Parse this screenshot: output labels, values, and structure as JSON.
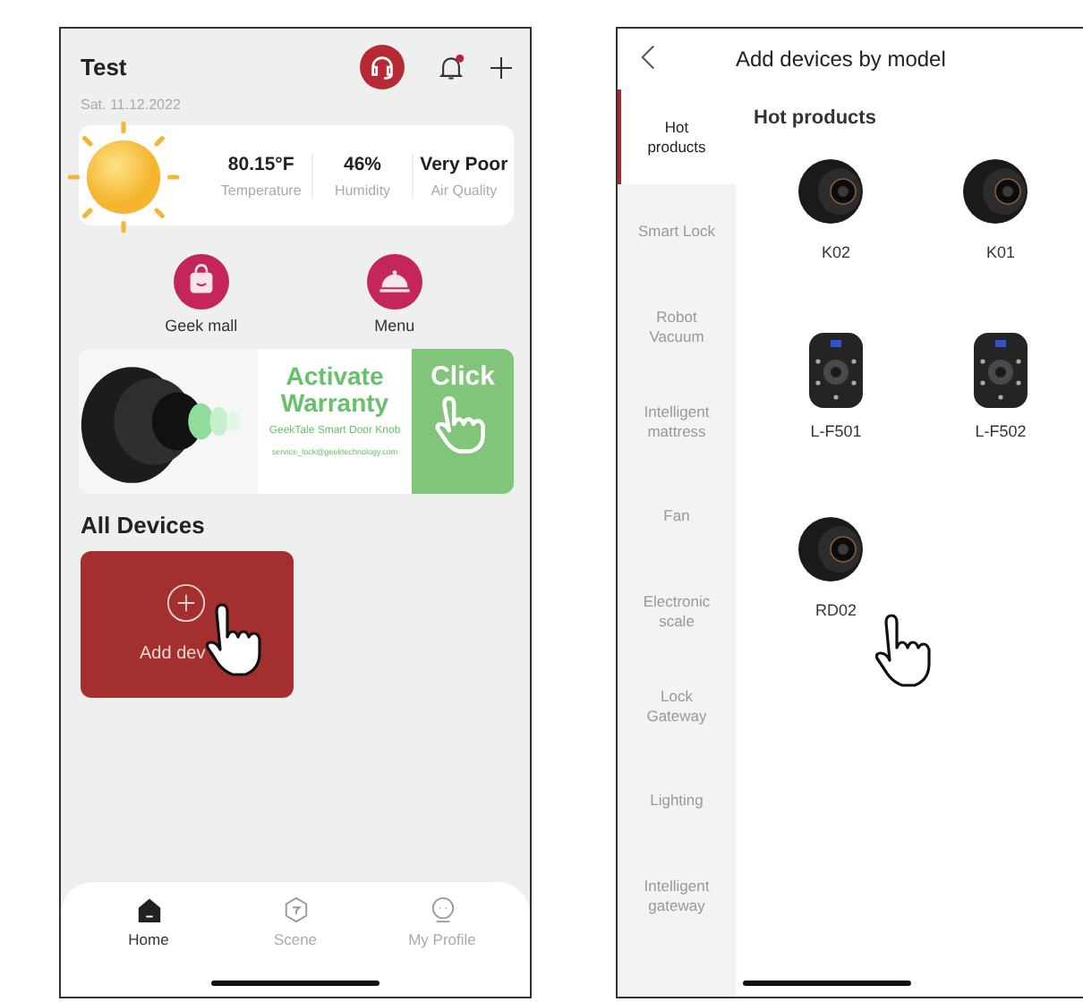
{
  "home": {
    "title": "Test",
    "date": "Sat. 11.12.2022",
    "notification_badge": true,
    "weather": [
      {
        "value": "80.15°F",
        "label": "Temperature"
      },
      {
        "value": "46%",
        "label": "Humidity"
      },
      {
        "value": "Very Poor",
        "label": "Air Quality"
      }
    ],
    "shortcuts": [
      {
        "label": "Geek mall",
        "kind": "mall"
      },
      {
        "label": "Menu",
        "kind": "menu"
      }
    ],
    "banner": {
      "title": "Activate Warranty",
      "subtitle": "GeekTale Smart Door Knob",
      "email": "service_lock@geektechnology.com",
      "action": "Click"
    },
    "section_title": "All Devices",
    "add_tile": {
      "label": "Add dev"
    },
    "tabs": [
      {
        "label": "Home",
        "kind": "home",
        "selected": true
      },
      {
        "label": "Scene",
        "kind": "scene",
        "selected": false
      },
      {
        "label": "My Profile",
        "kind": "profile",
        "selected": false
      }
    ]
  },
  "catalog": {
    "title": "Add devices by model",
    "categories": [
      {
        "label": "Hot products",
        "selected": true
      },
      {
        "label": "Smart Lock",
        "selected": false
      },
      {
        "label": "Robot Vacuum",
        "selected": false
      },
      {
        "label": "Intelligent mattress",
        "selected": false
      },
      {
        "label": "Fan",
        "selected": false
      },
      {
        "label": "Electronic scale",
        "selected": false
      },
      {
        "label": "Lock Gateway",
        "selected": false
      },
      {
        "label": "Lighting",
        "selected": false
      },
      {
        "label": "Intelligent gateway",
        "selected": false
      }
    ],
    "section_title": "Hot products",
    "products": [
      {
        "name": "K02",
        "kind": "knob"
      },
      {
        "name": "K01",
        "kind": "knob"
      },
      {
        "name": "L-F501",
        "kind": "keypad"
      },
      {
        "name": "L-F502",
        "kind": "keypad"
      },
      {
        "name": "RD02",
        "kind": "knob"
      }
    ]
  }
}
